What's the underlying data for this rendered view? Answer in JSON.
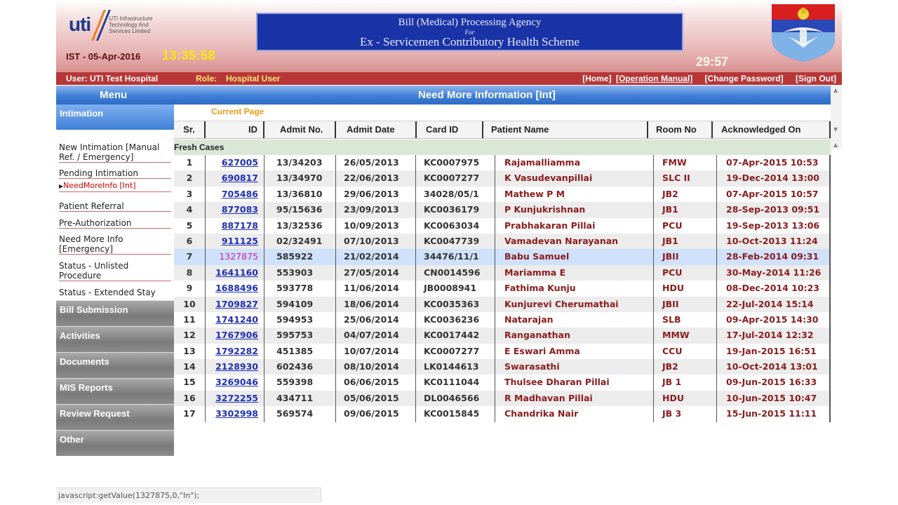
{
  "header": {
    "logo_text_line1": "UTI Infrastructure",
    "logo_text_line2": "Technology And",
    "logo_text_line3": "Services Limited",
    "logo_mark": "uti",
    "ist_date": "IST - 05-Apr-2016",
    "clock": "13:35:58",
    "banner_line1": "Bill (Medical) Processing Agency",
    "banner_line2": "For",
    "banner_line3": "Ex - Servicemen Contributory Health Scheme",
    "session_timer": "29:57",
    "emblem_icon": "army-emblem-icon"
  },
  "userbar": {
    "user": "User: UTI Test Hospital",
    "role_label": "Role:",
    "role_value": "Hospital User",
    "home": "[Home]",
    "manual": "[Operation Manual]",
    "change_password": "[Change Password]",
    "sign_out": "[Sign Out]"
  },
  "titlebar": {
    "menu": "Menu",
    "page_title": "Need More Information [Int]"
  },
  "sidebar": {
    "active_section": "Intimation",
    "items": [
      "New Intimation [Manual Ref. / Emergency]",
      "Pending Intimation",
      "NeedMoreInfo [Int]",
      "Patient Referral",
      "Pre-Authorization",
      "Need More Info [Emergency]",
      "Status - Unlisted Procedure",
      "Status - Extended Stay"
    ],
    "sections": [
      "Bill Submission",
      "Activities",
      "Documents",
      "MIS Reports",
      "Review Request",
      "Other"
    ]
  },
  "table": {
    "current_page_label": "Current Page",
    "headers": [
      "Sr.",
      "ID",
      "Admit No.",
      "Admit Date",
      "Card ID",
      "Patient Name",
      "Room No",
      "Acknowledged On"
    ],
    "group_label": "Fresh Cases",
    "rows": [
      {
        "sr": "1",
        "id": "627005",
        "admit_no": "13/34203",
        "admit_date": "26/05/2013",
        "card_id": "KC0007975",
        "name": "Rajamalliamma",
        "room": "FMW",
        "ack": "07-Apr-2015 10:53"
      },
      {
        "sr": "2",
        "id": "690817",
        "admit_no": "13/34970",
        "admit_date": "22/06/2013",
        "card_id": "KC0007277",
        "name": "K Vasudevanpillai",
        "room": "SLC II",
        "ack": "19-Dec-2014 13:00"
      },
      {
        "sr": "3",
        "id": "705486",
        "admit_no": "13/36810",
        "admit_date": "29/06/2013",
        "card_id": "34028/05/1",
        "name": "Mathew P M",
        "room": "JB2",
        "ack": "07-Apr-2015 10:57"
      },
      {
        "sr": "4",
        "id": "877083",
        "admit_no": "95/15636",
        "admit_date": "23/09/2013",
        "card_id": "KC0036179",
        "name": "P Kunjukrishnan",
        "room": "JB1",
        "ack": "28-Sep-2013 09:51"
      },
      {
        "sr": "5",
        "id": "887178",
        "admit_no": "13/32536",
        "admit_date": "10/09/2013",
        "card_id": "KC0063034",
        "name": "Prabhakaran Pillai",
        "room": "PCU",
        "ack": "19-Sep-2013 13:06"
      },
      {
        "sr": "6",
        "id": "911125",
        "admit_no": "02/32491",
        "admit_date": "07/10/2013",
        "card_id": "KC0047739",
        "name": "Vamadevan Narayanan",
        "room": "JB1",
        "ack": "10-Oct-2013 11:24"
      },
      {
        "sr": "7",
        "id": "1327875",
        "admit_no": "585922",
        "admit_date": "21/02/2014",
        "card_id": "34476/11/1",
        "name": "Babu Samuel",
        "room": "JBII",
        "ack": "28-Feb-2014 09:31"
      },
      {
        "sr": "8",
        "id": "1641160",
        "admit_no": "553903",
        "admit_date": "27/05/2014",
        "card_id": "CN0014596",
        "name": "Mariamma E",
        "room": "PCU",
        "ack": "30-May-2014 11:26"
      },
      {
        "sr": "9",
        "id": "1688496",
        "admit_no": "593778",
        "admit_date": "11/06/2014",
        "card_id": "JB0008941",
        "name": "Fathima Kunju",
        "room": "HDU",
        "ack": "08-Dec-2014 10:23"
      },
      {
        "sr": "10",
        "id": "1709827",
        "admit_no": "594109",
        "admit_date": "18/06/2014",
        "card_id": "KC0035363",
        "name": "Kunjurevi Cherumathai",
        "room": "JBII",
        "ack": "22-Jul-2014 15:14"
      },
      {
        "sr": "11",
        "id": "1741240",
        "admit_no": "594953",
        "admit_date": "25/06/2014",
        "card_id": "KC0036236",
        "name": "Natarajan",
        "room": "SLB",
        "ack": "09-Apr-2015 14:30"
      },
      {
        "sr": "12",
        "id": "1767906",
        "admit_no": "595753",
        "admit_date": "04/07/2014",
        "card_id": "KC0017442",
        "name": "Ranganathan",
        "room": "MMW",
        "ack": "17-Jul-2014 12:32"
      },
      {
        "sr": "13",
        "id": "1792282",
        "admit_no": "451385",
        "admit_date": "10/07/2014",
        "card_id": "KC0007277",
        "name": "E Eswari Amma",
        "room": "CCU",
        "ack": "19-Jan-2015 16:51"
      },
      {
        "sr": "14",
        "id": "2128930",
        "admit_no": "602436",
        "admit_date": "08/10/2014",
        "card_id": "LK0144613",
        "name": "Swarasathi",
        "room": "JB2",
        "ack": "10-Oct-2014 13:01"
      },
      {
        "sr": "15",
        "id": "3269046",
        "admit_no": "559398",
        "admit_date": "06/06/2015",
        "card_id": "KC0111044",
        "name": "Thulsee Dharan Pillai",
        "room": "JB 1",
        "ack": "09-Jun-2015 16:33"
      },
      {
        "sr": "16",
        "id": "3272255",
        "admit_no": "434711",
        "admit_date": "05/06/2015",
        "card_id": "DL0046566",
        "name": "R Madhavan Pillai",
        "room": "HDU",
        "ack": "10-Jun-2015 10:47"
      },
      {
        "sr": "17",
        "id": "3302998",
        "admit_no": "569574",
        "admit_date": "09/06/2015",
        "card_id": "KC0015845",
        "name": "Chandrika Nair",
        "room": "JB 3",
        "ack": "15-Jun-2015 11:11"
      }
    ],
    "selected_row": 7
  },
  "statusbar": {
    "text": "javascript:getValue(1327875,0,\"In\");"
  },
  "colors": {
    "header_red": "#b83636",
    "title_blue": "#3f7fd7",
    "link_blue": "#1f2fb4",
    "clock_yellow": "#ffeb00",
    "name_maroon": "#8a1c1c"
  }
}
